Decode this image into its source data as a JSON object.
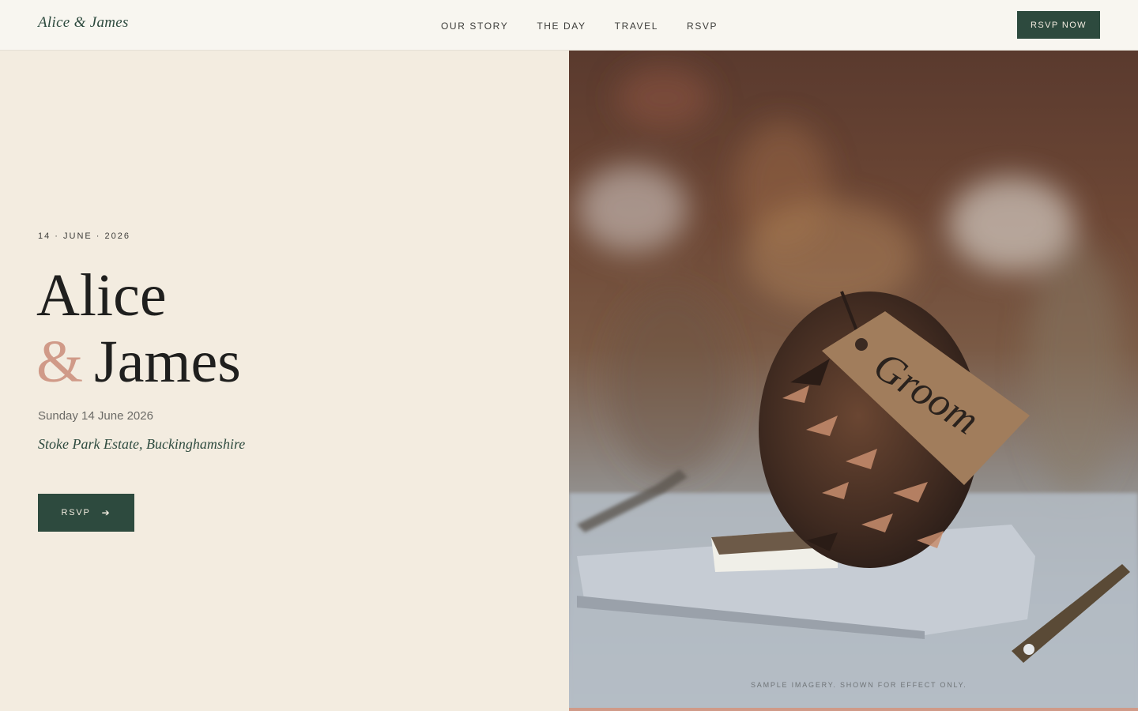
{
  "header": {
    "brand": "Alice & James",
    "nav": [
      "OUR STORY",
      "THE DAY",
      "TRAVEL",
      "RSVP"
    ],
    "cta": "RSVP NOW"
  },
  "hero": {
    "kicker": "14 · JUNE · 2026",
    "name_first": "Alice",
    "ampersand": "&",
    "name_second": "James",
    "date": "Sunday 14 June 2026",
    "venue": "Stoke Park Estate, Buckinghamshire",
    "rsvp_label": "RSVP",
    "rsvp_icon": "arrow-right-icon"
  },
  "image": {
    "tag_text": "Groom",
    "caption": "SAMPLE IMAGERY. SHOWN FOR EFFECT ONLY."
  },
  "colors": {
    "brand_green": "#2d4a3e",
    "accent_rose": "#d09a88",
    "cream": "#f3ece0"
  }
}
